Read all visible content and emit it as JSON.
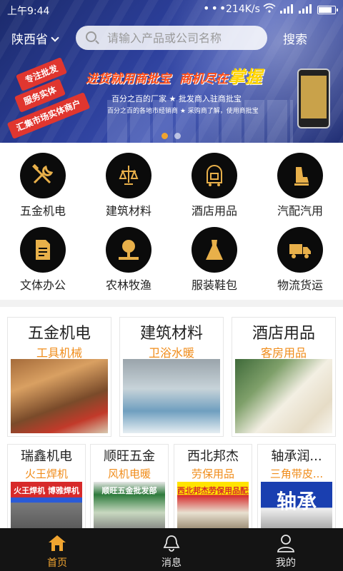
{
  "status_bar": {
    "time": "上午9:44",
    "network_speed": "214K/s"
  },
  "header": {
    "province": "陕西省",
    "search_placeholder": "请输入产品或公司名称",
    "search_button": "搜索"
  },
  "banner": {
    "tags": [
      "专注批发",
      "服务实体",
      "汇集市场实体商户"
    ],
    "slogan_part1": "进货就用商批宝",
    "slogan_part2": "商机尽在",
    "slogan_big": "掌握",
    "subline": "百分之百的厂家 ★ 批发商入驻商批宝",
    "subline2": "百分之百的各地市经销商 ★ 采购商了解，使用商批宝",
    "active_dot": 0,
    "dot_count": 2,
    "accent": "#f0a430"
  },
  "categories": [
    {
      "label": "五金机电",
      "icon": "tools-icon"
    },
    {
      "label": "建筑材料",
      "icon": "lamp-icon"
    },
    {
      "label": "酒店用品",
      "icon": "luggage-cart-icon"
    },
    {
      "label": "汽配汽用",
      "icon": "car-seat-icon"
    },
    {
      "label": "文体办公",
      "icon": "document-icon"
    },
    {
      "label": "农林牧渔",
      "icon": "tree-icon"
    },
    {
      "label": "服装鞋包",
      "icon": "dress-icon"
    },
    {
      "label": "物流货运",
      "icon": "truck-icon"
    }
  ],
  "featured": [
    {
      "title": "五金机电",
      "subtitle": "工具机械",
      "image": "tools-photo"
    },
    {
      "title": "建筑材料",
      "subtitle": "卫浴水暖",
      "image": "bathroom-photo"
    },
    {
      "title": "酒店用品",
      "subtitle": "客房用品",
      "image": "toiletries-photo"
    }
  ],
  "shops": [
    {
      "title": "瑞鑫机电",
      "subtitle": "火王焊机",
      "sign": "火王焊机 博雅焊机"
    },
    {
      "title": "顺旺五金",
      "subtitle": "风机电暖",
      "sign": "顺旺五金批发部"
    },
    {
      "title": "西北邦杰",
      "subtitle": "劳保用品",
      "sign": "西北邦杰劳保用品配送"
    },
    {
      "title": "轴承润...",
      "subtitle": "三角带皮...",
      "sign": "轴承"
    }
  ],
  "tabbar": [
    {
      "label": "首页",
      "icon": "home-icon",
      "active": true
    },
    {
      "label": "消息",
      "icon": "bell-icon",
      "active": false
    },
    {
      "label": "我的",
      "icon": "user-icon",
      "active": false
    }
  ]
}
